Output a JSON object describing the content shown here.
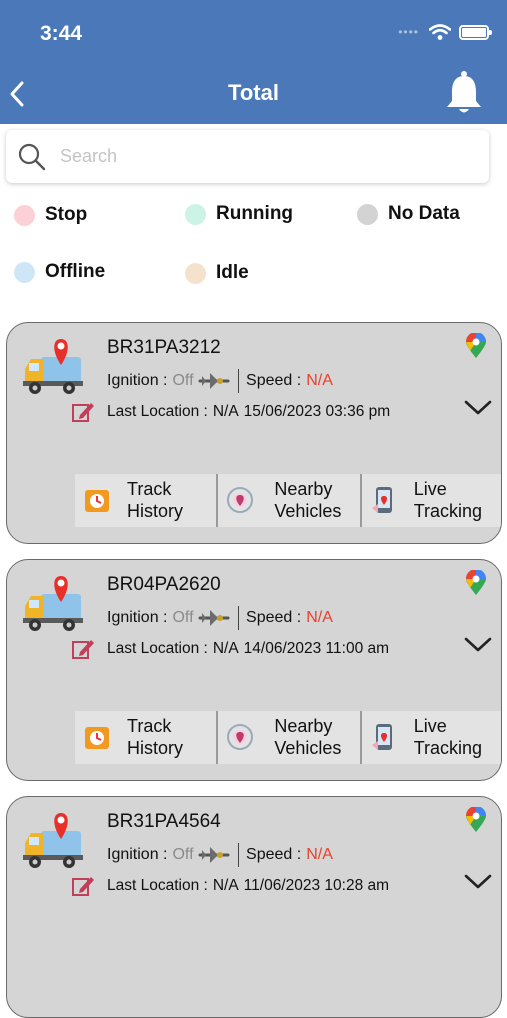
{
  "status_bar": {
    "time": "3:44"
  },
  "nav": {
    "title": "Total"
  },
  "search": {
    "placeholder": "Search",
    "value": ""
  },
  "legend": [
    {
      "label": "Stop",
      "color": "#fbd1d6"
    },
    {
      "label": "Running",
      "color": "#cdf2e6"
    },
    {
      "label": "No Data",
      "color": "#d3d3d3"
    },
    {
      "label": "Offline",
      "color": "#cfe6f7"
    },
    {
      "label": "Idle",
      "color": "#f5e2cc"
    }
  ],
  "vehicle_labels": {
    "ignition": "Ignition :",
    "speed": "Speed :",
    "last_location": "Last Location :"
  },
  "vehicles": [
    {
      "plate": "BR31PA3212",
      "ignition": "Off",
      "speed": "N/A",
      "location": "N/A",
      "datetime": "15/06/2023 03:36 pm"
    },
    {
      "plate": "BR04PA2620",
      "ignition": "Off",
      "speed": "N/A",
      "location": "N/A",
      "datetime": "14/06/2023 11:00 am"
    },
    {
      "plate": "BR31PA4564",
      "ignition": "Off",
      "speed": "N/A",
      "location": "N/A",
      "datetime": "11/06/2023 10:28 am"
    }
  ],
  "actions": {
    "track_history": "Track\nHistory",
    "nearby_vehicles": "Nearby\nVehicles",
    "live_tracking": "Live\nTracking"
  },
  "colors": {
    "header": "#4a78b8",
    "na": "#e8412f",
    "card": "#d5d5d5"
  }
}
